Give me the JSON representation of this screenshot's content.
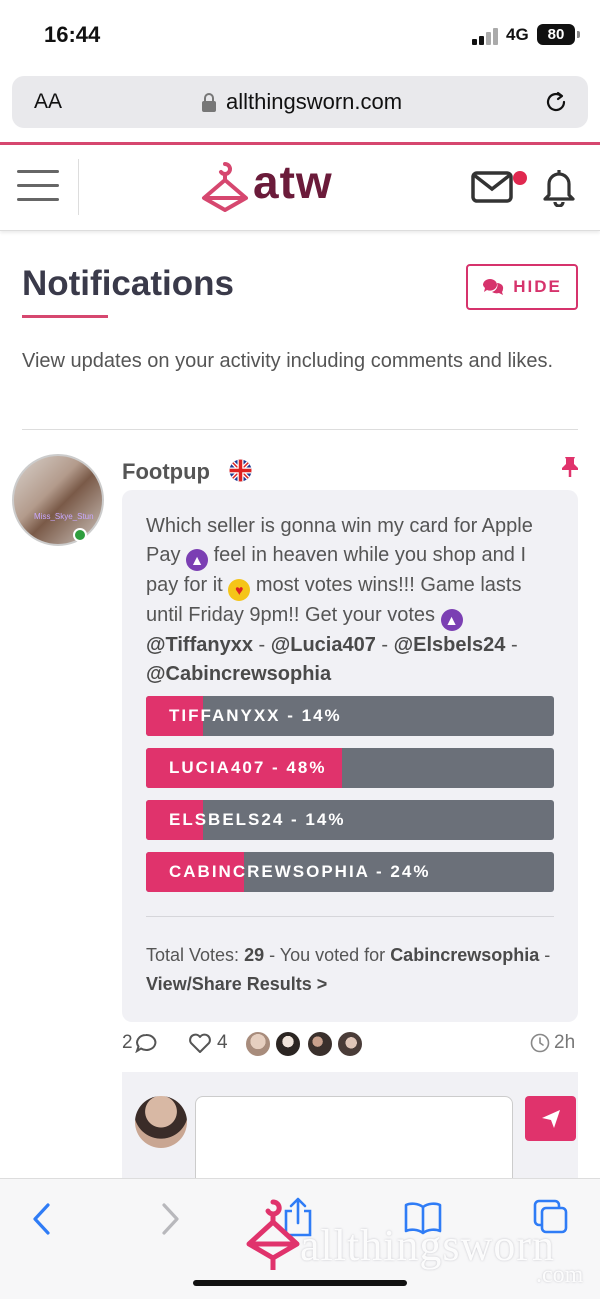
{
  "status_bar": {
    "time": "16:44",
    "network": "4G",
    "battery": "80"
  },
  "browser": {
    "text_size_label": "AA",
    "url": "allthingsworn.com"
  },
  "site": {
    "logo_text": "atw",
    "brand_color": "#d6476f",
    "accent_color": "#e0336c"
  },
  "page": {
    "title": "Notifications",
    "hide_button": "HIDE",
    "description": "View updates on your activity including comments and likes."
  },
  "post": {
    "author": "Footpup",
    "avatar_watermark": "Miss_Skye_Stun",
    "message": {
      "part1": "Which seller is gonna win my card for Apple Pay ",
      "part2": " feel in heaven while you shop and I pay for it ",
      "part3": " most votes wins!!! Game lasts until Friday 9pm!! Get your votes ",
      "mention1": "@Tiffanyxx",
      "sep1": " - ",
      "mention2": "@Lucia407",
      "sep2": " - ",
      "mention3": "@Elsbels24",
      "sep3": " - ",
      "mention4": "@Cabincrewsophia"
    },
    "poll": [
      {
        "label": "TIFFANYXX - 14%",
        "percent": 14
      },
      {
        "label": "LUCIA407 - 48%",
        "percent": 48
      },
      {
        "label": "ELSBELS24 - 14%",
        "percent": 14
      },
      {
        "label": "CABINCREWSOPHIA - 24%",
        "percent": 24
      }
    ],
    "totals": {
      "label": "Total Votes: ",
      "count": "29",
      "voted_text": " - You voted for ",
      "voted_for": "Cabincrewsophia",
      "dash": " - ",
      "results_link": "View/Share Results >"
    },
    "comment_count": "2",
    "like_count": "4",
    "time_ago": "2h"
  },
  "watermark": {
    "text": "allthingsworn",
    "suffix": ".com"
  }
}
